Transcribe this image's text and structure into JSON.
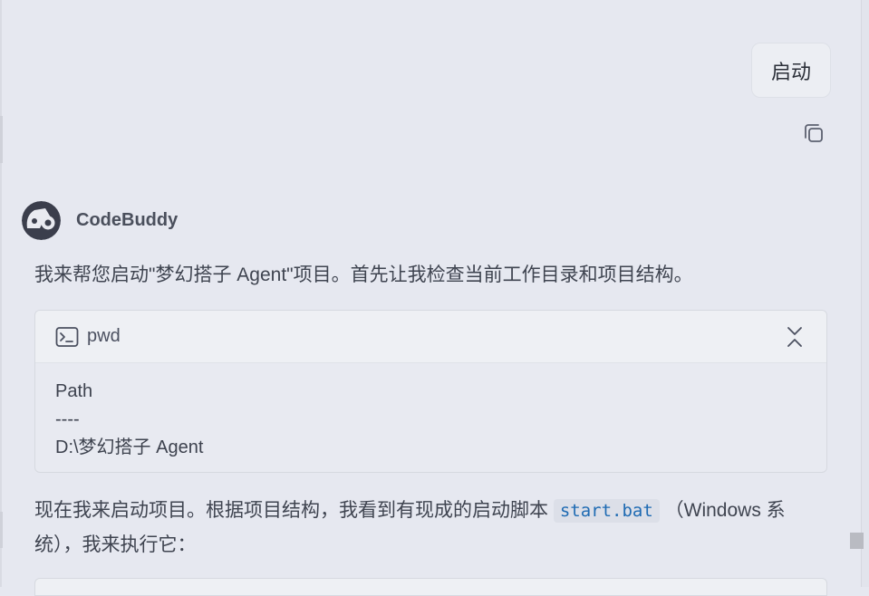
{
  "user_message": {
    "text": "启动"
  },
  "assistant": {
    "name": "CodeBuddy"
  },
  "intro_text": "我来帮您启动\"梦幻搭子 Agent\"项目。首先让我检查当前工作目录和项目结构。",
  "tool_call": {
    "command": "pwd",
    "output": [
      "Path",
      "----",
      "D:\\梦幻搭子 Agent"
    ]
  },
  "followup": {
    "before": "现在我来启动项目。根据项目结构，我看到有现成的启动脚本",
    "code": "start.bat",
    "after": "（Windows 系统），我来执行它："
  },
  "colors": {
    "background": "#e6e8f0",
    "code_text": "#1f6bb3",
    "bubble": "#eceef3"
  },
  "icons": [
    "copy-icon",
    "terminal-icon",
    "collapse-icon",
    "avatar-icon"
  ]
}
